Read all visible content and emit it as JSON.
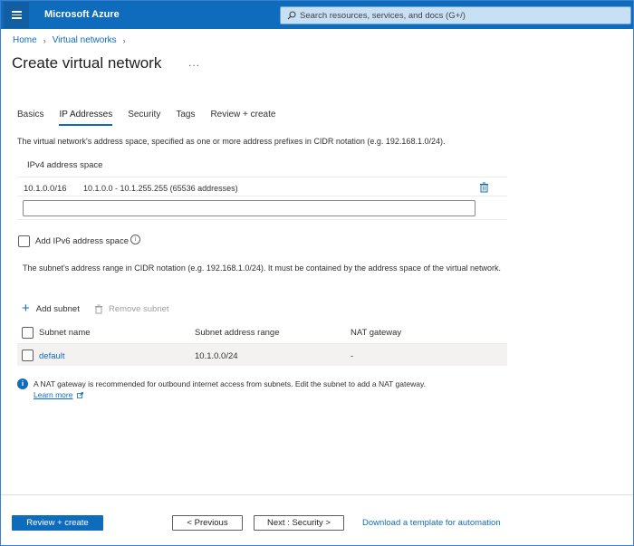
{
  "topbar": {
    "brand": "Microsoft Azure",
    "search_placeholder": "Search resources, services, and docs (G+/)"
  },
  "breadcrumb": {
    "items": [
      "Home",
      "Virtual networks"
    ]
  },
  "page": {
    "title": "Create virtual network",
    "more": "..."
  },
  "tabs": [
    {
      "label": "Basics",
      "active": false
    },
    {
      "label": "IP Addresses",
      "active": true
    },
    {
      "label": "Security",
      "active": false
    },
    {
      "label": "Tags",
      "active": false
    },
    {
      "label": "Review + create",
      "active": false
    }
  ],
  "ip": {
    "description": "The virtual network's address space, specified as one or more address prefixes in CIDR notation (e.g. 192.168.1.0/24).",
    "ipv4_header": "IPv4 address space",
    "ipv4_rows": [
      {
        "cidr": "10.1.0.0/16",
        "range": "10.1.0.0 - 10.1.255.255 (65536 addresses)"
      }
    ],
    "new_prefix_value": ""
  },
  "ipv6": {
    "label": "Add IPv6 address space",
    "checked": false
  },
  "subnets": {
    "description": "The subnet's address range in CIDR notation (e.g. 192.168.1.0/24). It must be contained by the address space of the virtual network.",
    "add_label": "Add subnet",
    "remove_label": "Remove subnet",
    "headers": [
      "Subnet name",
      "Subnet address range",
      "NAT gateway"
    ],
    "rows": [
      {
        "name": "default",
        "range": "10.1.0.0/24",
        "nat": "-"
      }
    ]
  },
  "nat_info": {
    "text": "A NAT gateway is recommended for outbound internet access from subnets. Edit the subnet to add a NAT gateway.",
    "learn_more": "Learn more"
  },
  "footer": {
    "review_create": "Review + create",
    "previous": "< Previous",
    "next": "Next : Security >",
    "download": "Download a template for automation"
  },
  "colors": {
    "accent": "#0f6cbd",
    "topbar": "#0f6cbd",
    "search_bg": "#c7e0f4"
  }
}
